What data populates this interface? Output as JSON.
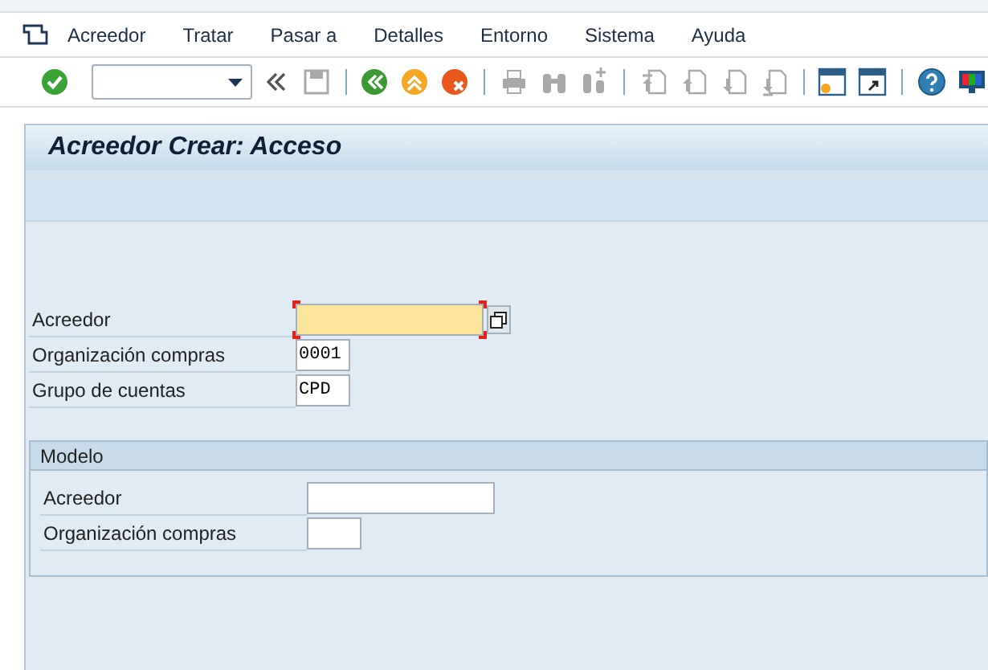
{
  "menu_bar": [
    {
      "label": "Acreedor"
    },
    {
      "label": "Tratar"
    },
    {
      "label": "Pasar a"
    },
    {
      "label": "Detalles"
    },
    {
      "label": "Entorno"
    },
    {
      "label": "Sistema"
    },
    {
      "label": "Ayuda"
    }
  ],
  "toolbar": [
    {
      "kind": "enter",
      "disabled": false
    },
    {
      "kind": "command"
    },
    {
      "kind": "collapse",
      "disabled": false
    },
    {
      "kind": "save",
      "disabled": true
    },
    {
      "kind": "separator"
    },
    {
      "kind": "back",
      "disabled": false
    },
    {
      "kind": "exit",
      "disabled": false
    },
    {
      "kind": "cancel",
      "disabled": false
    },
    {
      "kind": "separator"
    },
    {
      "kind": "print",
      "disabled": true
    },
    {
      "kind": "find",
      "disabled": true
    },
    {
      "kind": "find-next",
      "disabled": true
    },
    {
      "kind": "separator"
    },
    {
      "kind": "first-page",
      "disabled": true
    },
    {
      "kind": "prev-page",
      "disabled": true
    },
    {
      "kind": "next-page",
      "disabled": true
    },
    {
      "kind": "last-page",
      "disabled": true
    },
    {
      "kind": "separator"
    },
    {
      "kind": "new-session",
      "disabled": false
    },
    {
      "kind": "shortcut",
      "disabled": false
    },
    {
      "kind": "separator"
    },
    {
      "kind": "help",
      "disabled": false
    },
    {
      "kind": "layout",
      "disabled": false
    }
  ],
  "title": "Acreedor Crear: Acceso",
  "fields": [
    {
      "label": "Acreedor",
      "kind": "wide",
      "focused": true,
      "help": true
    },
    {
      "label": "Organización compras",
      "kind": "narrow",
      "value": "0001",
      "focused": false
    },
    {
      "label": "Grupo de cuentas",
      "kind": "narrow",
      "value": "CPD",
      "focused": false
    }
  ],
  "group": {
    "title": "Modelo",
    "fields": [
      {
        "label": "Acreedor",
        "kind": "wide",
        "focused": false
      },
      {
        "label": "Organización compras",
        "kind": "narrow",
        "focused": false
      }
    ]
  }
}
